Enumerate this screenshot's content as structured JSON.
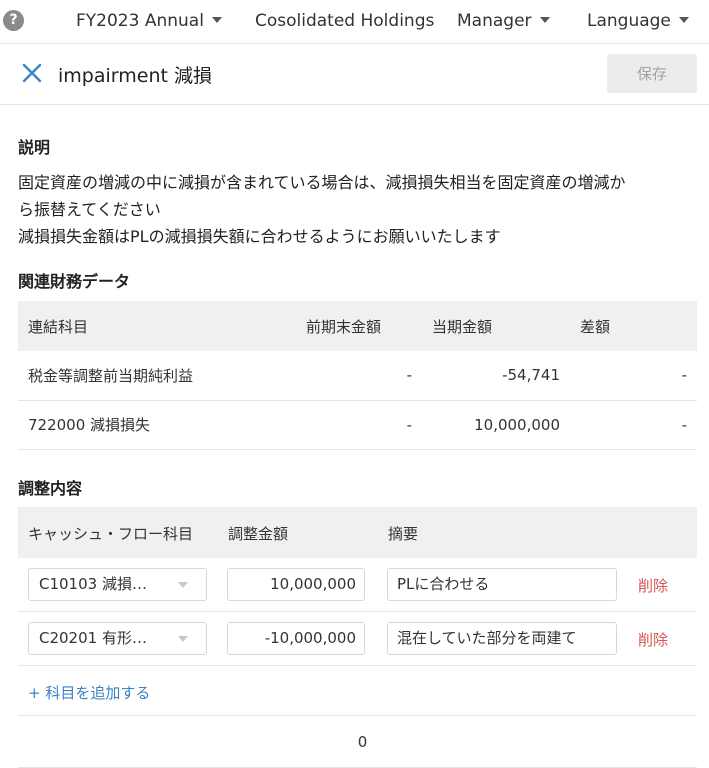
{
  "nav": {
    "fiscal_year": "FY2023 Annual",
    "entity": "Cosolidated Holdings",
    "role": "Manager",
    "language": "Language"
  },
  "header": {
    "title": "impairment 減損",
    "save_label": "保存"
  },
  "description": {
    "heading": "説明",
    "line1": "固定資産の増減の中に減損が含まれている場合は、減損損失相当を固定資産の増減か",
    "line2": "ら振替えてください",
    "line3": "減損損失金額はPLの減損損失額に合わせるようにお願いいたします"
  },
  "financial_data": {
    "heading": "関連財務データ",
    "columns": [
      "連結科目",
      "前期末金額",
      "当期金額",
      "差額"
    ],
    "rows": [
      {
        "account": "税金等調整前当期純利益",
        "prev": "-",
        "current": "-54,741",
        "diff": "-"
      },
      {
        "account": "722000 減損損失",
        "prev": "-",
        "current": "10,000,000",
        "diff": "-"
      }
    ]
  },
  "adjustments": {
    "heading": "調整内容",
    "columns": [
      "キャッシュ・フロー科目",
      "調整金額",
      "摘要"
    ],
    "rows": [
      {
        "account": "C10103 減損…",
        "amount": "10,000,000",
        "memo": "PLに合わせる",
        "delete_label": "削除"
      },
      {
        "account": "C20201 有形…",
        "amount": "-10,000,000",
        "memo": "混在していた部分を両建て",
        "delete_label": "削除"
      }
    ],
    "add_label": "+ 科目を追加する",
    "total": "0"
  },
  "colors": {
    "accent": "#3b82c4",
    "danger": "#d9534f",
    "header_bg": "#f0f0f0"
  }
}
